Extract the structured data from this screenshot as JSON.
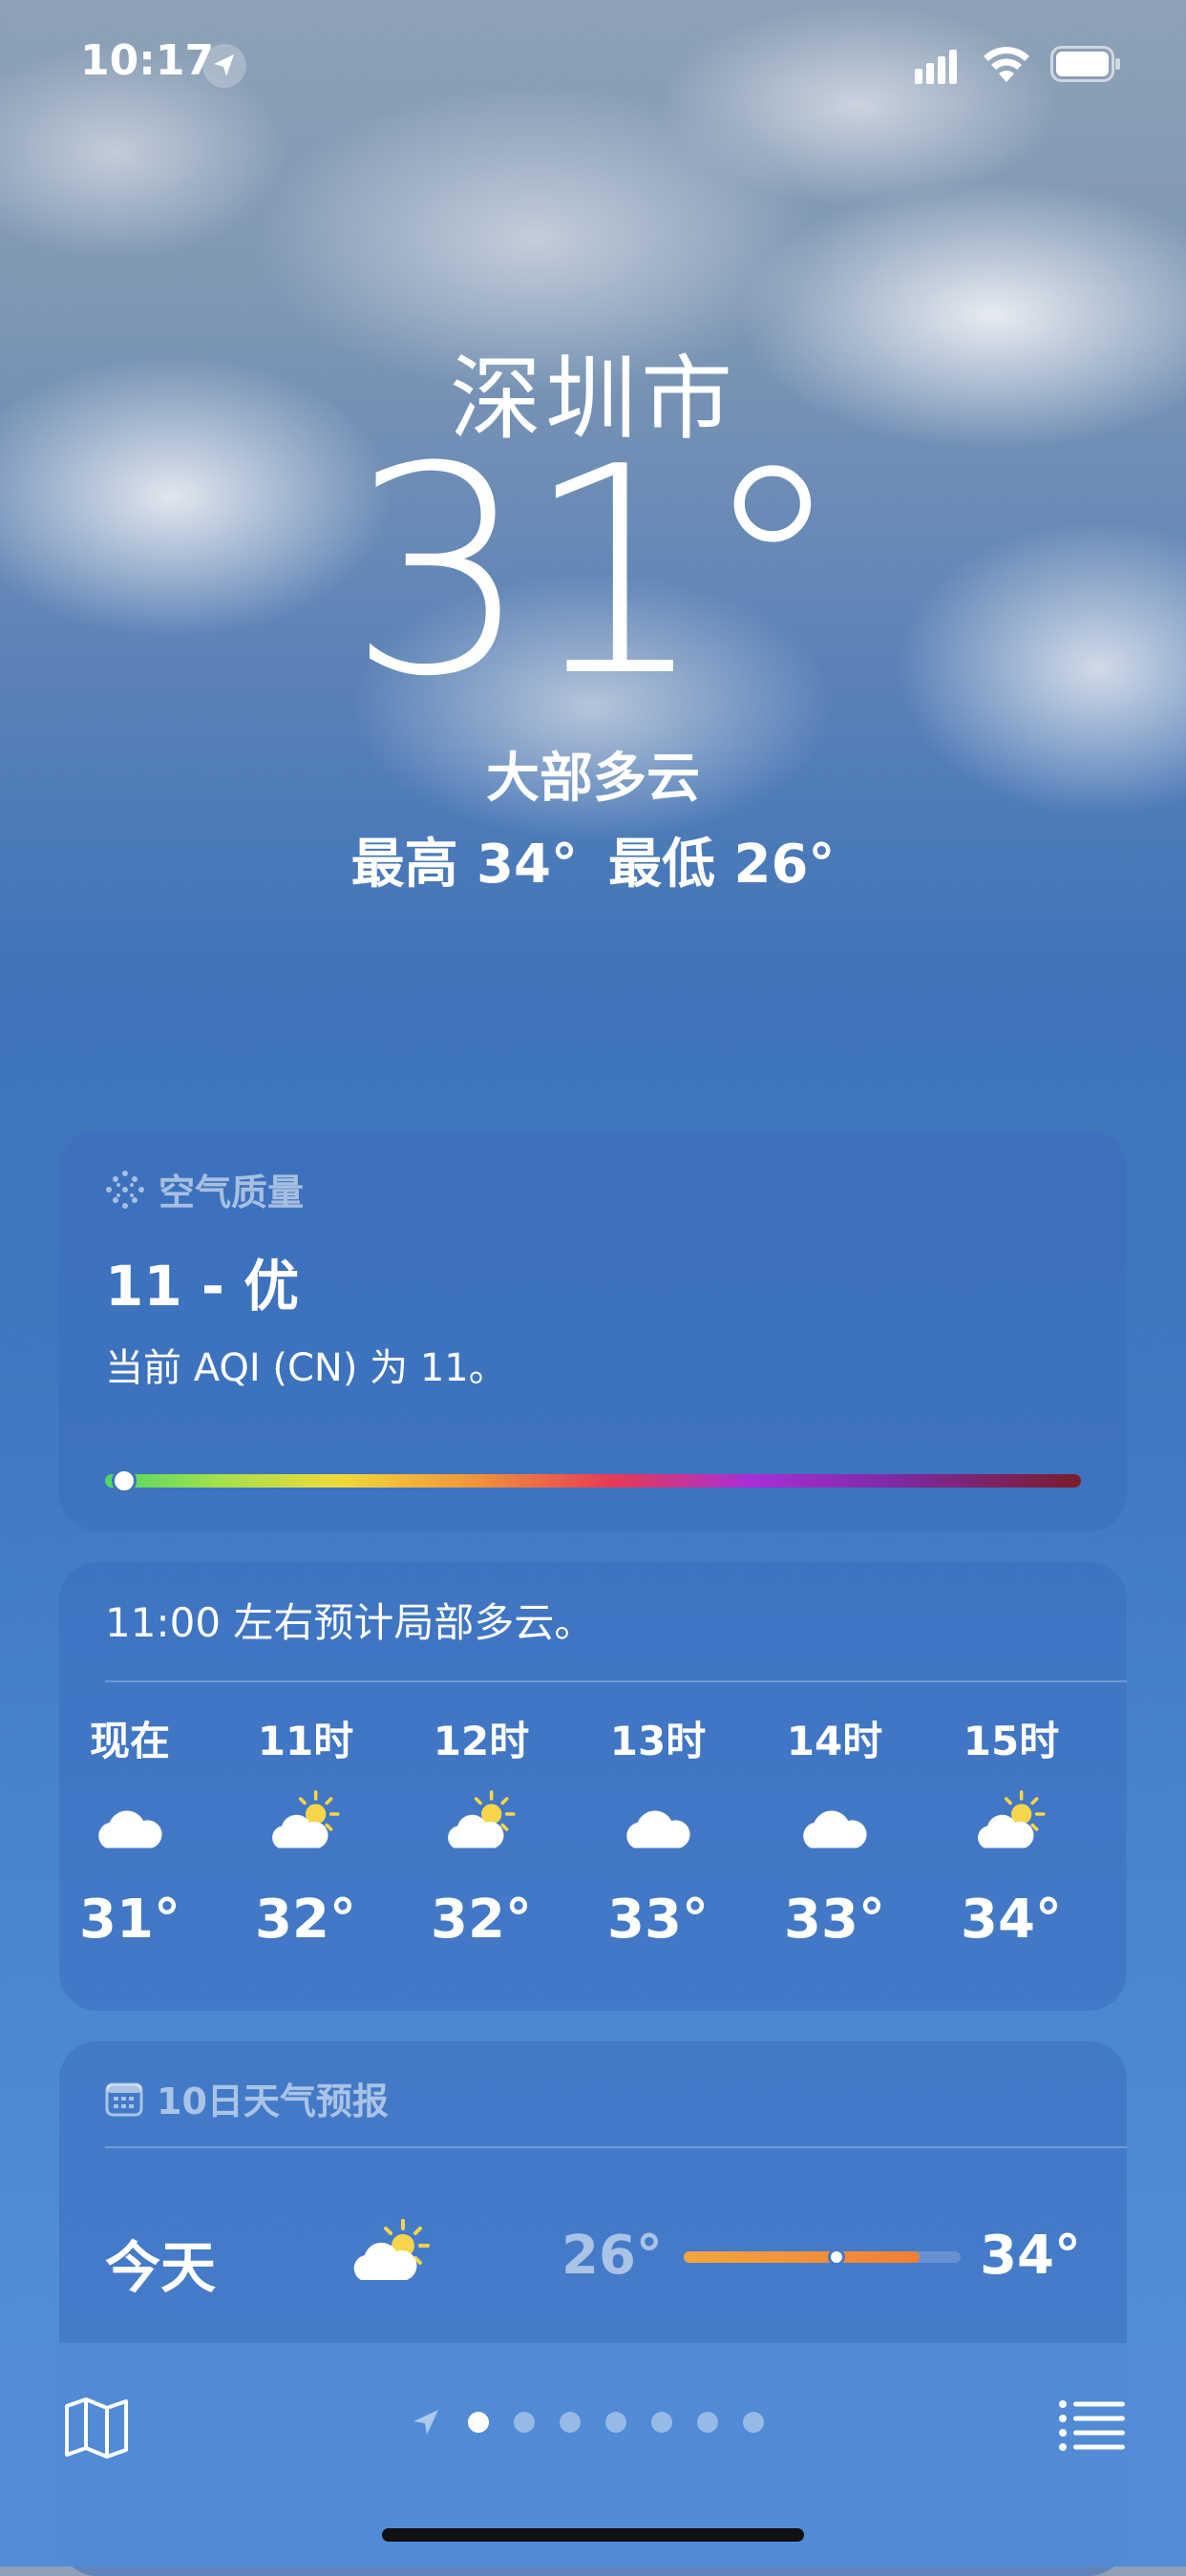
{
  "status_bar": {
    "time": "10:17"
  },
  "header": {
    "city": "深圳市",
    "temperature": "31°",
    "condition": "大部多云",
    "high": "最高 34°",
    "low": "最低 26°"
  },
  "air_quality": {
    "title": "空气质量",
    "value": "11 - 优",
    "description": "当前 AQI (CN) 为 11。",
    "level_fraction": 0.02
  },
  "hourly": {
    "summary": "11:00 左右预计局部多云。",
    "items": [
      {
        "label": "现在",
        "icon": "cloud-icon",
        "temp": "31°"
      },
      {
        "label": "11时",
        "icon": "partly-sunny-icon",
        "temp": "32°"
      },
      {
        "label": "12时",
        "icon": "partly-sunny-icon",
        "temp": "32°"
      },
      {
        "label": "13时",
        "icon": "cloud-icon",
        "temp": "33°"
      },
      {
        "label": "14时",
        "icon": "cloud-icon",
        "temp": "33°"
      },
      {
        "label": "15时",
        "icon": "partly-sunny-icon",
        "temp": "34°"
      }
    ]
  },
  "ten_day": {
    "title": "10日天气预报",
    "days": [
      {
        "name": "今天",
        "icon": "partly-sunny-icon",
        "low": "26°",
        "high": "34°",
        "range_start": 0.0,
        "range_end": 0.85,
        "current": 0.55
      }
    ]
  },
  "toolbar": {
    "page_count": 7,
    "active_page": 0
  },
  "colors": {
    "aqi_gradient": [
      "#4cd964",
      "#a6e04b",
      "#f0d93a",
      "#f2933a",
      "#e73a55",
      "#a92fd6",
      "#7f2aa8",
      "#7a1d2a"
    ],
    "temp_range": "#f3a53f"
  }
}
